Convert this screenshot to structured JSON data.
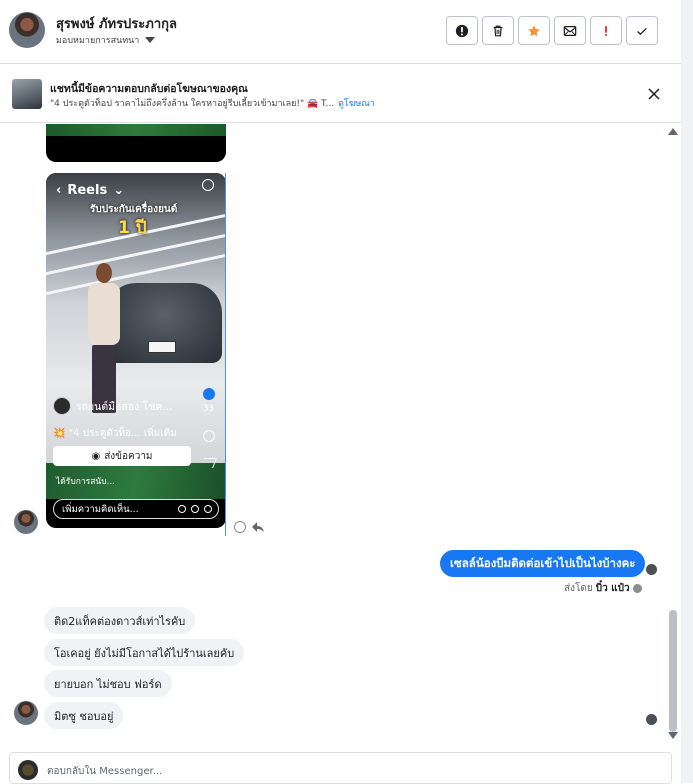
{
  "header": {
    "contact_name": "สุรพงษ์ ภัทรประภากุล",
    "assign_label": "มอบหมายการสนทนา"
  },
  "toolbar": {
    "buttons": [
      {
        "name": "spam-alert",
        "icon": "alert-circle-icon"
      },
      {
        "name": "delete",
        "icon": "trash-icon"
      },
      {
        "name": "star",
        "icon": "star-icon",
        "color": "#f7923b"
      },
      {
        "name": "mark-unread",
        "icon": "envelope-icon"
      },
      {
        "name": "important",
        "icon": "exclamation-icon",
        "color": "#e02424"
      },
      {
        "name": "done",
        "icon": "check-icon"
      }
    ]
  },
  "ad_banner": {
    "title": "แชทนี้มีข้อความตอบกลับต่อโฆษณาของคุณ",
    "subtitle": "\"4 ประตูตัวท็อป ราคาไม่ถึงครึ่งล้าน ใครหาอยู่รีบเลี้ยวเข้ามาเลย!\" 🚘 T...",
    "link": "ดูโฆษณา"
  },
  "reel": {
    "title": "Reels",
    "overlay_text": "รับประกันเครื่องยนต์",
    "overlay_number": "1 ปี",
    "page_name": "รถยนต์มือสอง โชค...",
    "like_count": "33",
    "caption": "💥 \"4 ประตูตัวท็อ... เพิ่มเติม",
    "send_button": "ส่งข้อความ",
    "sponsored": "ได้รับการสนับ...",
    "comment_placeholder": "เพิ่มความคิดเห็น..."
  },
  "messages": {
    "outgoing": "เซลล์น้องบีมติดต่อเข้าไปเป็นไงบ้างคะ",
    "sent_by_label": "ส่งโดย",
    "sent_by_name": "บิ๋ว แป๋ว",
    "incoming": [
      "ติด2แท็คต่องดาวส์เท่าไรคับ",
      "โอเคอยู่ ยังไม่มีโอกาสได้ไปร้านเลยคับ",
      "ยายบอก ไม่ชอบ ฟอร์ด",
      "มิตซู ชอบอยู่"
    ]
  },
  "composer": {
    "placeholder": "ตอบกลับใน Messenger..."
  },
  "colors": {
    "accent": "#1877f2",
    "bubble_in": "#f0f2f5"
  }
}
